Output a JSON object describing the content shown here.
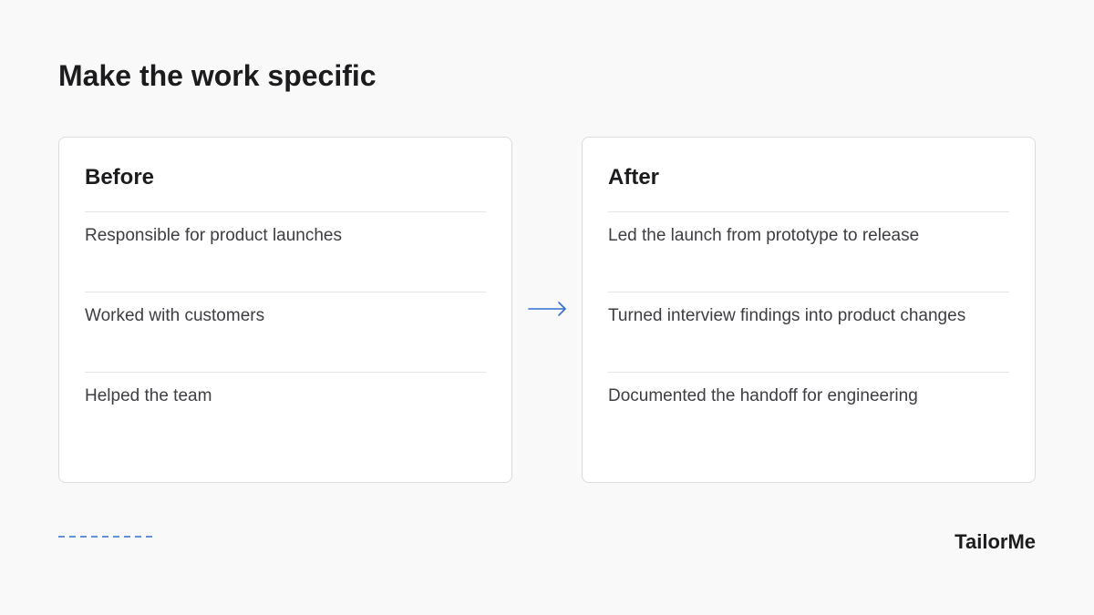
{
  "title": "Make the work specific",
  "before": {
    "heading": "Before",
    "items": [
      "Responsible for product launches",
      "Worked with customers",
      "Helped the team"
    ]
  },
  "after": {
    "heading": "After",
    "items": [
      "Led the launch from prototype to release",
      "Turned interview findings into product changes",
      "Documented the handoff for engineering"
    ]
  },
  "brand": "TailorMe",
  "colors": {
    "accent": "#2f6fd6",
    "background": "#f9f9f9",
    "card": "#ffffff",
    "text": "#1c1c1e",
    "muted_text": "#3d3d42"
  },
  "icons": {
    "transition": "arrow-right-icon"
  }
}
